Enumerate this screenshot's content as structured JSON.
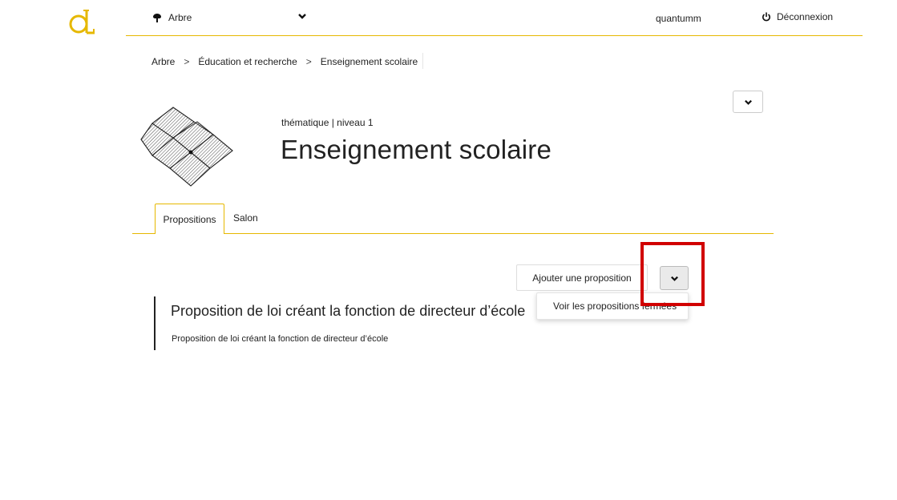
{
  "logo": {
    "alt_text": "dL"
  },
  "topnav": {
    "tree_label": "Arbre",
    "username": "quantumm",
    "logout_label": "Déconnexion"
  },
  "breadcrumb": {
    "items": [
      "Arbre",
      "Éducation et recherche",
      "Enseignement scolaire"
    ],
    "separator": ">"
  },
  "header": {
    "subtitle": "thématique | niveau 1",
    "title": "Enseignement scolaire"
  },
  "tabs": [
    {
      "label": "Propositions",
      "active": true
    },
    {
      "label": "Salon",
      "active": false
    }
  ],
  "actions": {
    "add_label": "Ajouter une proposition",
    "dropdown_item": "Voir les propositions fermées"
  },
  "proposals": [
    {
      "title": "Proposition de loi créant la fonction de directeur d’école",
      "description": "Proposition de loi créant la fonction de directeur d’école"
    }
  ],
  "colors": {
    "accent": "#e6b800",
    "highlight": "#d10000"
  },
  "icons": [
    "tree-icon",
    "chevron-down-icon",
    "power-icon",
    "box-illustration"
  ]
}
